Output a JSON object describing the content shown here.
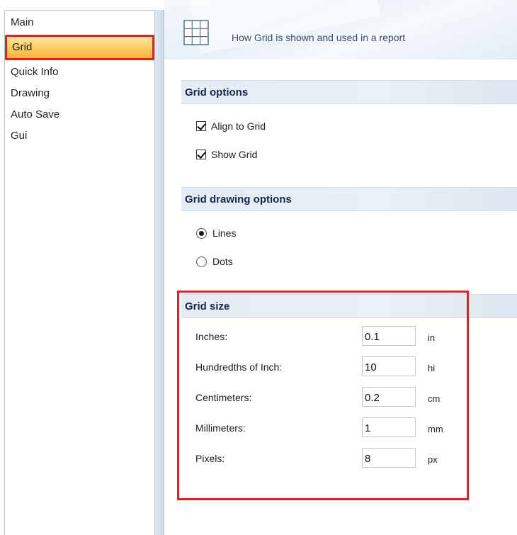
{
  "nav": {
    "items": [
      {
        "label": "Main"
      },
      {
        "label": "Grid",
        "selected": true
      },
      {
        "label": "Quick Info"
      },
      {
        "label": "Drawing"
      },
      {
        "label": "Auto Save"
      },
      {
        "label": "Gui"
      }
    ]
  },
  "header": {
    "icon": "grid-icon",
    "description": "How Grid is shown and used in a report"
  },
  "grid_options": {
    "title": "Grid options",
    "align_to_grid": {
      "label": "Align to Grid",
      "checked": true
    },
    "show_grid": {
      "label": "Show Grid",
      "checked": true
    }
  },
  "grid_drawing_options": {
    "title": "Grid drawing options",
    "lines": {
      "label": "Lines",
      "selected": true
    },
    "dots": {
      "label": "Dots",
      "selected": false
    }
  },
  "grid_size": {
    "title": "Grid size",
    "rows": [
      {
        "label": "Inches:",
        "value": "0.1",
        "unit": "in"
      },
      {
        "label": "Hundredths of Inch:",
        "value": "10",
        "unit": "hi"
      },
      {
        "label": "Centimeters:",
        "value": "0.2",
        "unit": "cm"
      },
      {
        "label": "Millimeters:",
        "value": "1",
        "unit": "mm"
      },
      {
        "label": "Pixels:",
        "value": "8",
        "unit": "px"
      }
    ]
  },
  "colors": {
    "highlight_border": "#d9252a",
    "selected_item": "#fccf6a",
    "section_title": "#15294b",
    "section_bar": "#e4ebf4"
  }
}
